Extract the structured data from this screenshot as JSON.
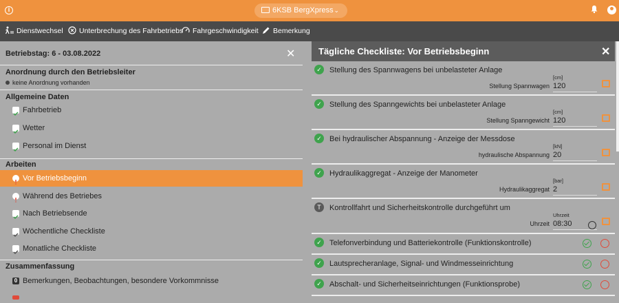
{
  "app": {
    "project": "6KSB BergXpress",
    "colors": {
      "accent": "#ef923e",
      "ok": "#3fa34d",
      "nok": "#e04a3a"
    }
  },
  "toolbar": {
    "items": [
      {
        "label": "Dienstwechsel",
        "icon": "person-walk-icon"
      },
      {
        "label": "Unterbrechung des Fahrbetriebs",
        "icon": "cancel-circle-icon"
      },
      {
        "label": "Fahrgeschwindigkeit",
        "icon": "speedometer-icon"
      },
      {
        "label": "Bemerkung",
        "icon": "pencil-icon"
      }
    ]
  },
  "left": {
    "title": "Betriebstag: 6 - 03.08.2022",
    "anordnung_heading": "Anordnung durch den Betriebsleiter",
    "anordnung_status": "keine Anordnung vorhanden",
    "allgemein_heading": "Allgemeine Daten",
    "allgemein": [
      "Fahrbetrieb",
      "Wetter",
      "Personal im Dienst"
    ],
    "arbeiten_heading": "Arbeiten",
    "arbeiten": [
      "Vor Betriebsbeginn",
      "Während des Betriebes",
      "Nach Betriebsende",
      "Wöchentliche Checkliste",
      "Monatliche Checkliste"
    ],
    "zusammenfassung_heading": "Zusammenfassung",
    "bemerkungen_count": "0",
    "bemerkungen": "Bemerkungen, Beobachtungen, besondere Vorkommnisse"
  },
  "checklist": {
    "title": "Tägliche Checkliste: Vor Betriebsbeginn",
    "items": [
      {
        "title": "Stellung des Spannwagens bei unbelasteter Anlage",
        "unit": "[cm]",
        "field_label": "Stellung Spannwagen",
        "value": "120"
      },
      {
        "title": "Stellung des Spanngewichts bei unbelasteter Anlage",
        "unit": "[cm]",
        "field_label": "Stellung Spanngewicht",
        "value": "120"
      },
      {
        "title": "Bei hydraulischer Abspannung - Anzeige der Messdose",
        "unit": "[kN]",
        "field_label": "hydraulische Abspannung",
        "value": "20"
      },
      {
        "title": "Hydraulikaggregat - Anzeige der Manometer",
        "unit": "[bar]",
        "field_label": "Hydraulikaggregat",
        "value": "2"
      },
      {
        "title": "Kontrollfahrt und Sicherheitskontrolle durchgeführt um",
        "unit": "Uhrzeit",
        "field_label": "Uhrzeit",
        "value": "08:30",
        "status_letter": "T"
      },
      {
        "title": "Telefonverbindung und Batteriekontrolle (Funktionskontrolle)"
      },
      {
        "title": "Lautsprecheranlage, Signal- und Windmesseinrichtung"
      },
      {
        "title": "Abschalt- und Sicherheitseinrichtungen (Funktionsprobe)"
      }
    ]
  }
}
